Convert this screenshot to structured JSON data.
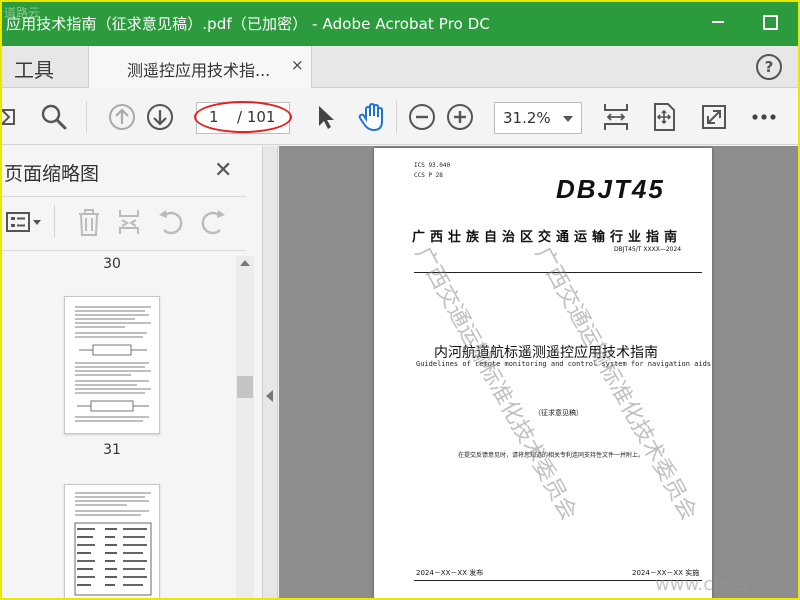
{
  "window": {
    "title": "应用技术指南（征求意见稿）.pdf（已加密） - Adobe Acrobat Pro DC",
    "title_watermark": "道路云"
  },
  "tabs": {
    "tools_label": "工具",
    "doc_tab_label": "测遥控应用技术指...",
    "doc_tab_close": "×",
    "help": "?"
  },
  "toolbar": {
    "current_page": "1",
    "total_pages": "/ 101",
    "zoom": "31.2%"
  },
  "panel": {
    "title": "页面缩略图",
    "close": "✕",
    "thumbnails": [
      {
        "label": "30"
      },
      {
        "label": "31"
      }
    ]
  },
  "document": {
    "ics": "ICS 93.040",
    "ccs": "CCS P 28",
    "code_large": "DBJT45",
    "std_title": "广西壮族自治区交通运输行业指南",
    "std_number": "DBJT45/T XXXX—2024",
    "main_title": "内河航道航标遥测遥控应用技术指南",
    "english_title": "Guidelines of remote monitoring and control system for navigation aids",
    "draft_label": "（征求意见稿）",
    "note": "在提交反馈意见时，请将您知道的相关专利连同支持性文件一并附上。",
    "publish_date": "2024－XX－XX 发布",
    "implement_date": "2024－XX－XX 实施",
    "watermark_1": "广西交通运输标准化技术委员会",
    "watermark_2": "广西交通运输标准化技术委员会",
    "watermark_url": "www.cnda"
  }
}
